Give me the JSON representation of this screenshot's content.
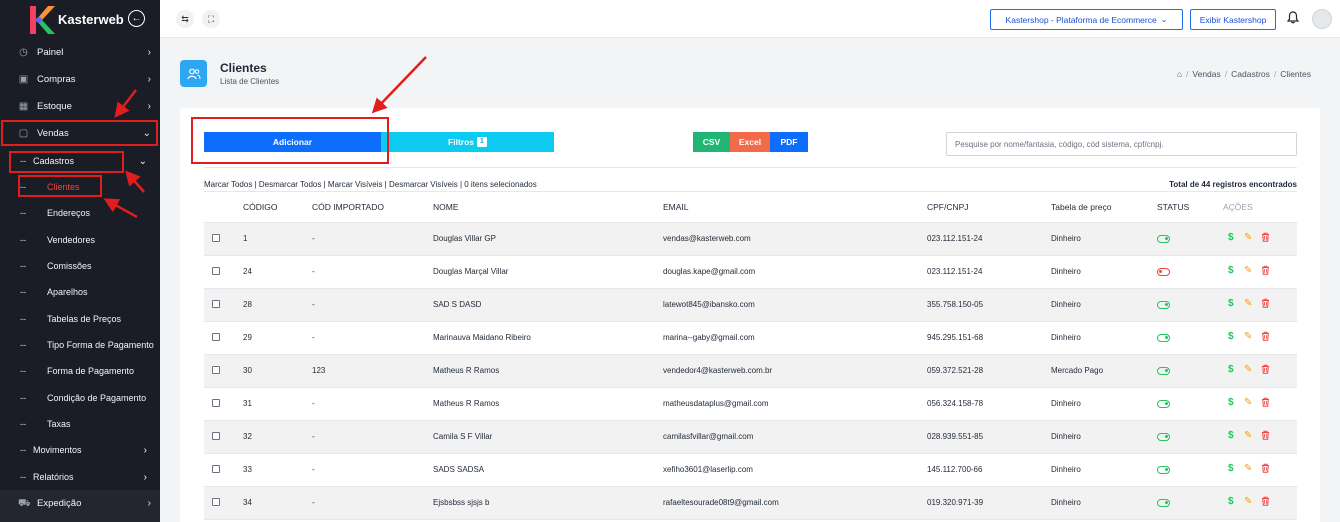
{
  "app": {
    "brand": "Kasterweb"
  },
  "sidebar": {
    "items": [
      {
        "label": "Painel",
        "icon": "gauge-icon"
      },
      {
        "label": "Compras",
        "icon": "box-icon"
      },
      {
        "label": "Estoque",
        "icon": "cube-icon"
      },
      {
        "label": "Vendas",
        "icon": "bag-icon"
      },
      {
        "label": "Movimentos"
      },
      {
        "label": "Relatórios"
      },
      {
        "label": "Expedição",
        "icon": "truck-icon"
      }
    ],
    "group": {
      "label": "Cadastros",
      "prefix": "--"
    },
    "sub_items": [
      "Clientes",
      "Endereços",
      "Vendedores",
      "Comissões",
      "Aparelhos",
      "Tabelas de Preços",
      "Tipo Forma de Pagamento",
      "Forma de Pagamento",
      "Condição de Pagamento",
      "Taxas"
    ]
  },
  "topbar": {
    "store_select": "Kastershop - Plataforma de Ecommerce",
    "show_store": "Exibir Kastershop"
  },
  "page": {
    "title": "Clientes",
    "subtitle": "Lista de Clientes",
    "breadcrumb": [
      "Vendas",
      "Cadastros",
      "Clientes"
    ]
  },
  "toolbar": {
    "add": "Adicionar",
    "filters": "Filtros",
    "filters_count": "1",
    "csv": "CSV",
    "excel": "Excel",
    "pdf": "PDF",
    "search_placeholder": "Pesquise por nome/fantasia, código, cód sistema, cpf/cnpj."
  },
  "selection_links": "Marcar Todos | Desmarcar Todos | Marcar Visíveis | Desmarcar Visíveis | 0 itens selecionados",
  "total": "Total de 44 registros encontrados",
  "table": {
    "headers": [
      "CÓDIGO",
      "CÓD IMPORTADO",
      "NOME",
      "EMAIL",
      "CPF/CNPJ",
      "Tabela de preço",
      "STATUS",
      "AÇÕES"
    ],
    "rows": [
      {
        "codigo": "1",
        "cod_importado": "-",
        "nome": "Douglas Villar GP",
        "email": "vendas@kasterweb.com",
        "cpf": "023.112.151-24",
        "tabela": "Dinheiro",
        "status": "active"
      },
      {
        "codigo": "24",
        "cod_importado": "-",
        "nome": "Douglas Marçal Villar",
        "email": "douglas.kape@gmail.com",
        "cpf": "023.112.151-24",
        "tabela": "Dinheiro",
        "status": "inactive"
      },
      {
        "codigo": "28",
        "cod_importado": "-",
        "nome": "SAD S DASD",
        "email": "latewot845@ibansko.com",
        "cpf": "355.758.150-05",
        "tabela": "Dinheiro",
        "status": "active"
      },
      {
        "codigo": "29",
        "cod_importado": "-",
        "nome": "Marinauva Maidano Ribeiro",
        "email": "marina--gaby@gmail.com",
        "cpf": "945.295.151-68",
        "tabela": "Dinheiro",
        "status": "active"
      },
      {
        "codigo": "30",
        "cod_importado": "123",
        "nome": "Matheus R Ramos",
        "email": "vendedor4@kasterweb.com.br",
        "cpf": "059.372.521-28",
        "tabela": "Mercado Pago",
        "status": "active"
      },
      {
        "codigo": "31",
        "cod_importado": "-",
        "nome": "Matheus R Ramos",
        "email": "matheusdataplus@gmail.com",
        "cpf": "056.324.158-78",
        "tabela": "Dinheiro",
        "status": "active"
      },
      {
        "codigo": "32",
        "cod_importado": "-",
        "nome": "Camila S F Villar",
        "email": "camilasfvillar@gmail.com",
        "cpf": "028.939.551-85",
        "tabela": "Dinheiro",
        "status": "active"
      },
      {
        "codigo": "33",
        "cod_importado": "-",
        "nome": "SADS SADSA",
        "email": "xefiho3601@laserlip.com",
        "cpf": "145.112.700-66",
        "tabela": "Dinheiro",
        "status": "active"
      },
      {
        "codigo": "34",
        "cod_importado": "-",
        "nome": "Ejsbsbss sjsjs b",
        "email": "rafaeltesourade08t9@gmail.com",
        "cpf": "019.320.971-39",
        "tabela": "Dinheiro",
        "status": "active"
      }
    ]
  },
  "colors": {
    "sidebar": "#1a1d26",
    "primary": "#0d6efd",
    "filter": "#0dcaf0",
    "csv": "#21b573",
    "excel": "#f26a4a",
    "pdf": "#0d6efd",
    "annotation": "#e11d1d"
  }
}
